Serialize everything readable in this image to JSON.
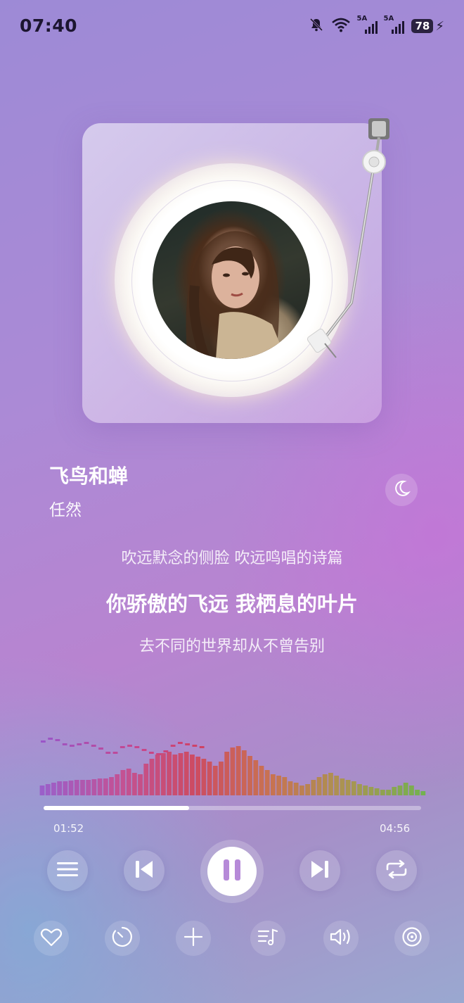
{
  "status_bar": {
    "time": "07:40",
    "signal_1_label": "5A",
    "signal_2_label": "5A",
    "battery": "78",
    "icons": [
      "mute-bell-icon",
      "wifi-icon",
      "signal-icon",
      "signal-icon",
      "battery-icon",
      "charging-icon"
    ]
  },
  "player": {
    "title": "飞鸟和蝉",
    "artist": "任然",
    "lyrics": {
      "previous": "吹远默念的侧脸 吹远鸣唱的诗篇",
      "current": "你骄傲的飞远 我栖息的叶片",
      "next": "去不同的世界却从不曾告别"
    },
    "current_time": "01:52",
    "total_time": "04:56",
    "progress": 0.385
  },
  "controls": {
    "main": [
      "playlist-menu-icon",
      "previous-icon",
      "pause-icon",
      "next-icon",
      "repeat-icon"
    ],
    "bottom": [
      "heart-icon",
      "timer-icon",
      "add-icon",
      "queue-icon",
      "volume-icon",
      "disc-icon"
    ]
  },
  "colors": {
    "spectrum_start": "#9a55c8",
    "spectrum_mid": "#d0404f",
    "spectrum_end": "#6ab83a",
    "accent": "#ffffff"
  }
}
